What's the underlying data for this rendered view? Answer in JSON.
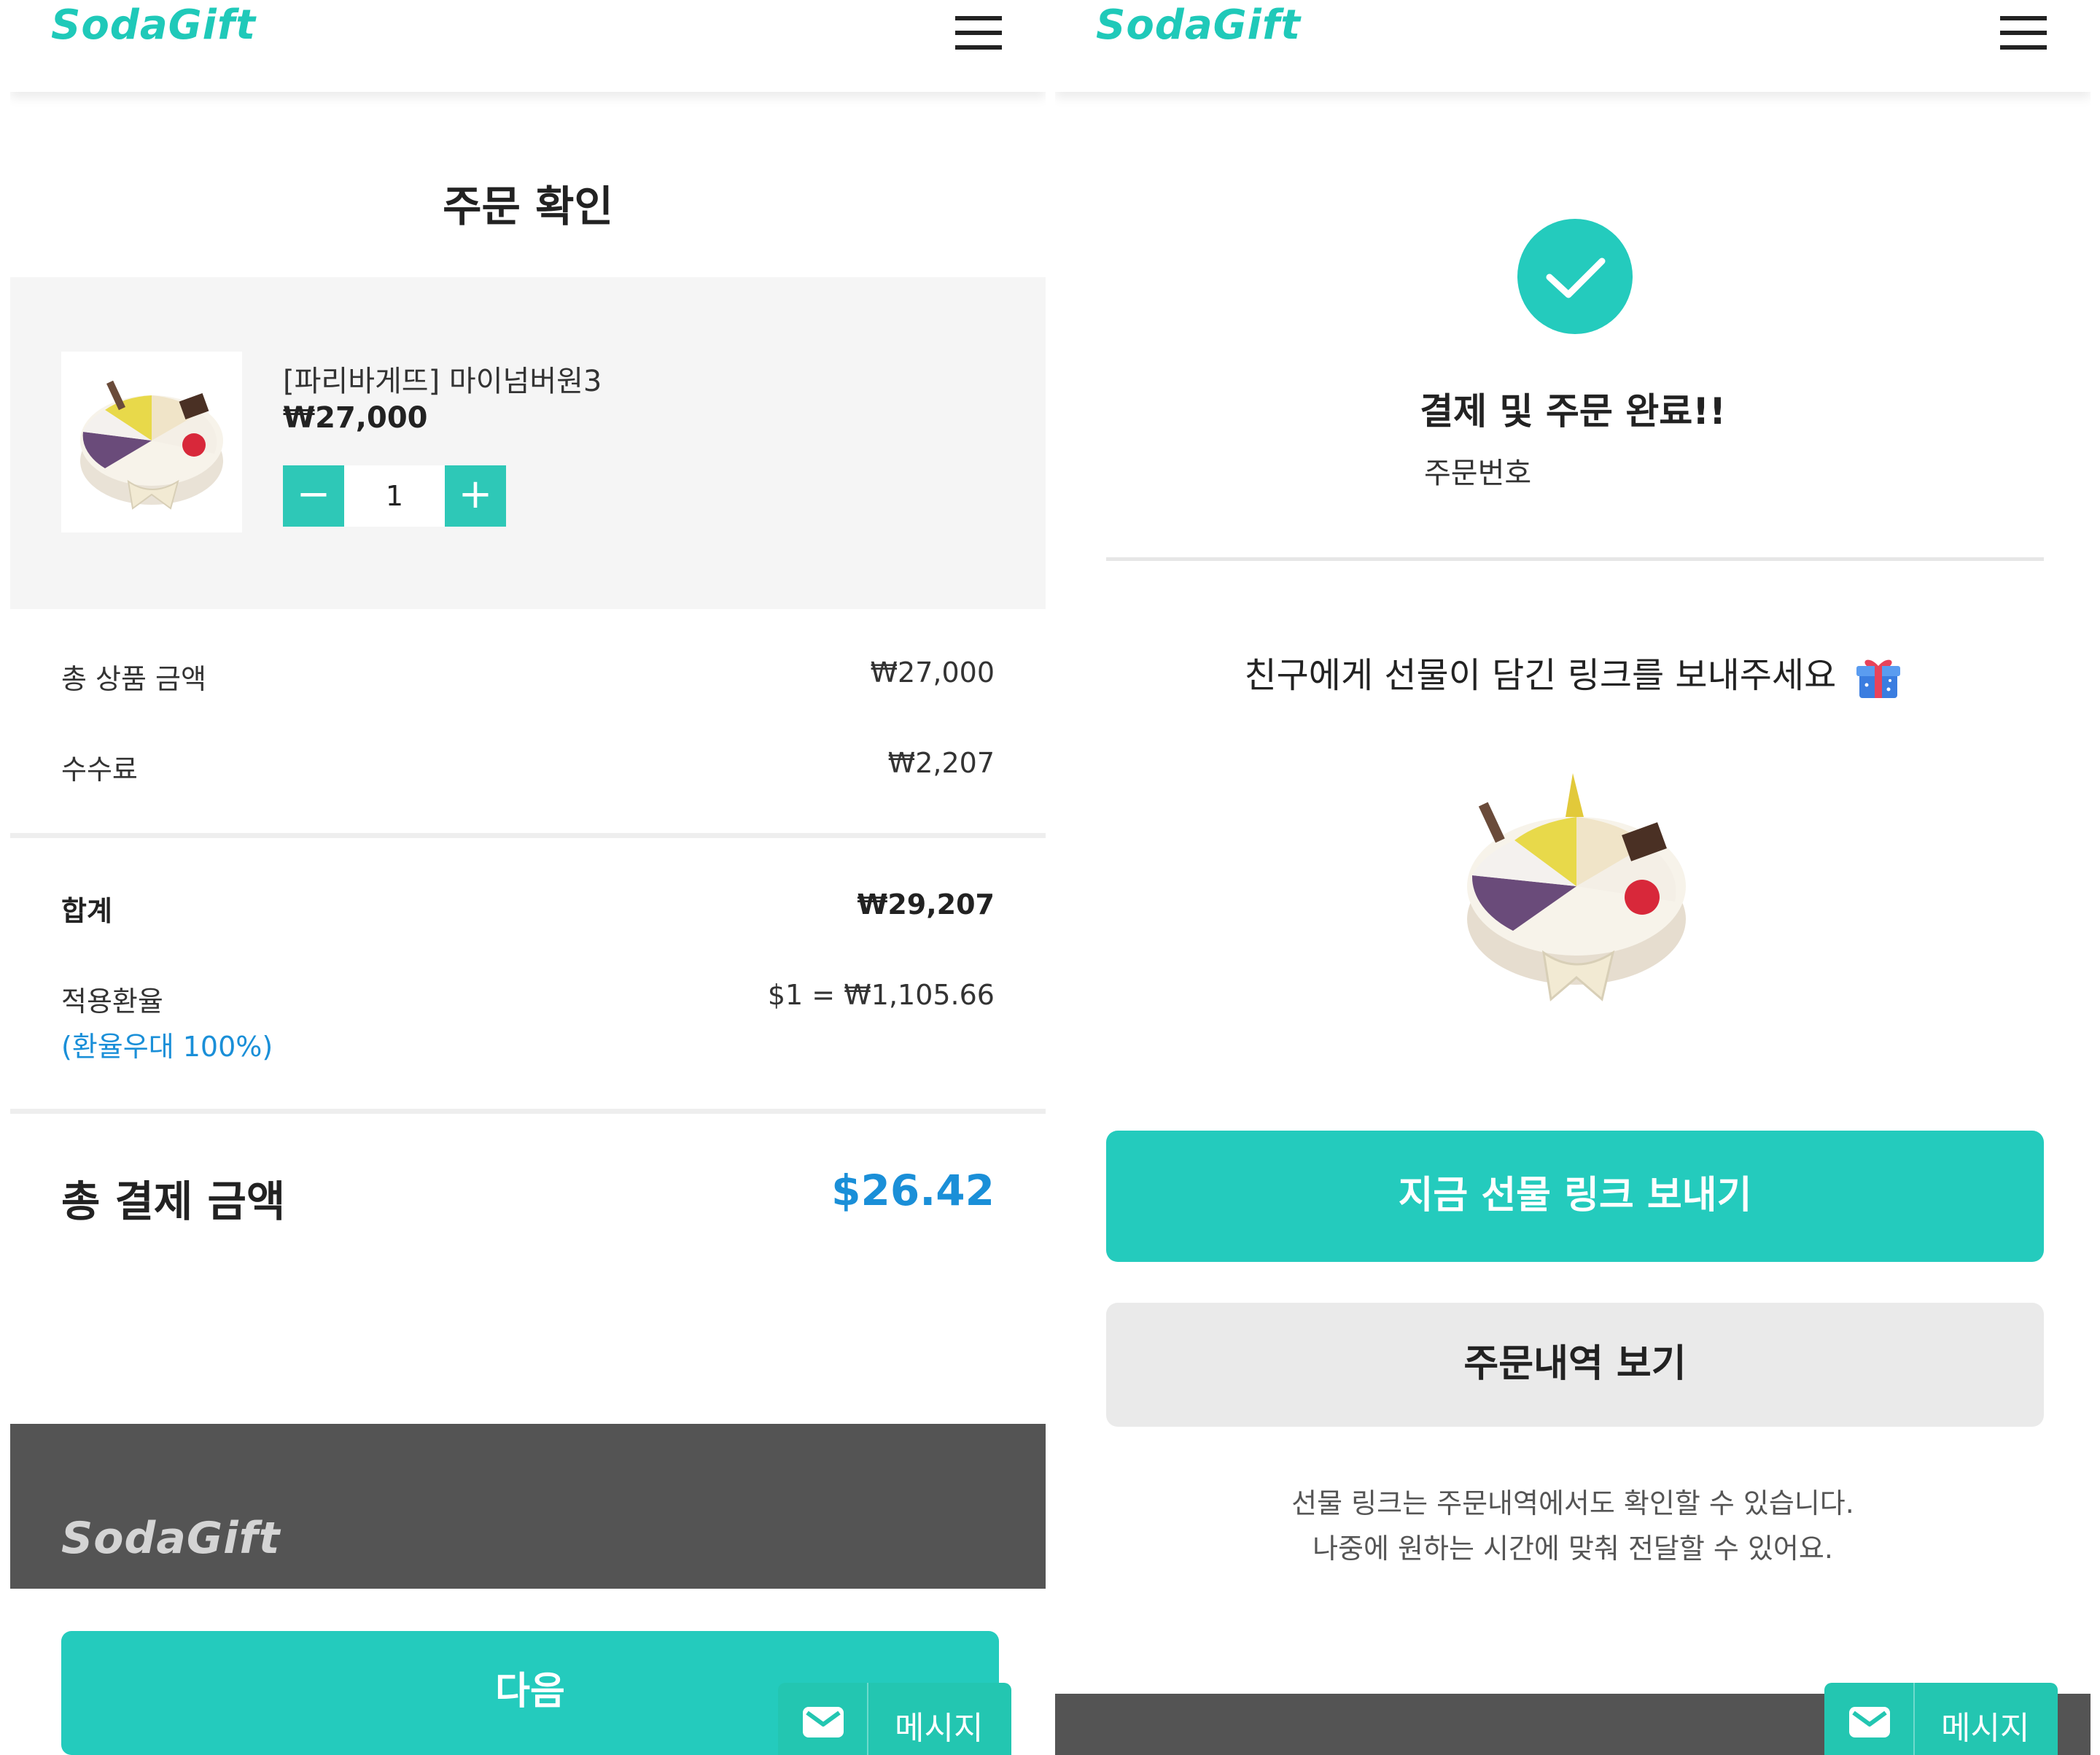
{
  "brand": {
    "name": "SodaGift",
    "accent": "#24cbbd",
    "price_accent": "#1a8fd8",
    "footer_bg": "#545454"
  },
  "left": {
    "header": {
      "logo": "SodaGift",
      "menu_icon": "hamburger-icon"
    },
    "title": "주문 확인",
    "product": {
      "name": "[파리바게뜨] 마이넘버원3",
      "price": "₩27,000",
      "quantity": "1",
      "minus_label": "−",
      "plus_label": "+"
    },
    "summary": {
      "subtotal_label": "총 상품 금액",
      "subtotal_value": "₩27,000",
      "fee_label": "수수료",
      "fee_value": "₩2,207",
      "sum_label": "합계",
      "sum_value": "₩29,207",
      "rate_label": "적용환율",
      "rate_value": "$1 = ₩1,105.66",
      "rate_discount": "(환율우대 100%)",
      "total_label": "총 결제 금액",
      "total_value": "$26.42"
    },
    "footer_logo": "SodaGift",
    "next_button": "다음",
    "message_button": "메시지"
  },
  "right": {
    "header": {
      "logo": "SodaGift",
      "menu_icon": "hamburger-icon"
    },
    "done_title": "결제 및 주문 완료!!",
    "order_number_label": "주문번호",
    "send_prompt": "친구에게 선물이 담긴 링크를 보내주세요",
    "send_now_button": "지금 선물 링크 보내기",
    "order_history_button": "주문내역 보기",
    "note_line1": "선물 링크는 주문내역에서도 확인할 수 있습니다.",
    "note_line2": "나중에 원하는 시간에 맞춰 전달할 수 있어요.",
    "message_button": "메시지"
  }
}
